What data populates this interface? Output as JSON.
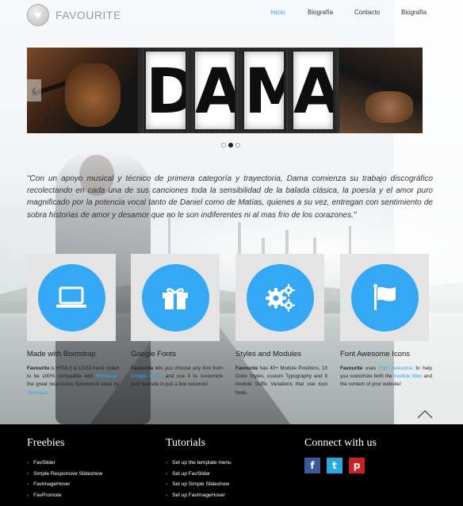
{
  "header": {
    "logo_text": "FAVOURITE",
    "logo_icon": "heart-icon",
    "nav": [
      {
        "label": "Inicio",
        "active": true
      },
      {
        "label": "Biografía",
        "active": false
      },
      {
        "label": "Contacto",
        "active": false
      },
      {
        "label": "Biografía",
        "active": false
      }
    ]
  },
  "slider": {
    "banner_text": "DAMA",
    "prev_icon": "chevron-left-icon",
    "next_icon": "chevron-right-icon",
    "slide_count": 3,
    "active_slide": 2
  },
  "quote": "\"Con un apoyo musical y técnico de primera categoría y trayectoria, Dama comienza su trabajo discográfico recolectando en cada una de sus canciones toda la sensibilidad de la balada clásica, la poesía y el amor puro magnificado por la potencia vocal tanto de Daniel como de Matías, quienes a su vez, entregan con sentimiento de sobra historias de amor y desamor que no le son indiferentes ni al mas frio de los corazones.\"",
  "features": [
    {
      "icon": "laptop-icon",
      "title": "Made with Bootstrap",
      "parts": [
        {
          "t": "Favourite",
          "s": "b"
        },
        {
          "t": " is HTML5 & CSS3 hand coded to be 100% compatible with ",
          "s": ""
        },
        {
          "t": "Bootstrap",
          "s": "lnk"
        },
        {
          "t": ", the great responsive framework used by ",
          "s": ""
        },
        {
          "t": "Joomla!3",
          "s": "lnk"
        },
        {
          "t": ".",
          "s": ""
        }
      ]
    },
    {
      "icon": "gift-icon",
      "title": "Google Fonts",
      "parts": [
        {
          "t": "Favourite",
          "s": "b"
        },
        {
          "t": " lets you choose any font from ",
          "s": ""
        },
        {
          "t": "Google Fonts",
          "s": "lnk"
        },
        {
          "t": " and use it to customize your website in just a few seconds!",
          "s": ""
        }
      ]
    },
    {
      "icon": "gears-icon",
      "title": "Styles and Modules",
      "parts": [
        {
          "t": "Favourite",
          "s": "b"
        },
        {
          "t": " has 40+ Module Positions, 10 Color Styles, custom Typography and 8 module Suffix Variations that use icon fonts.",
          "s": ""
        }
      ]
    },
    {
      "icon": "flag-icon",
      "title": "Font Awesome Icons",
      "parts": [
        {
          "t": "Favourite",
          "s": "b"
        },
        {
          "t": " uses ",
          "s": ""
        },
        {
          "t": "Font Awesome",
          "s": "lnk"
        },
        {
          "t": " to help you customize both the ",
          "s": ""
        },
        {
          "t": "module titles",
          "s": "lnk"
        },
        {
          "t": " and the content of your website!",
          "s": ""
        }
      ]
    }
  ],
  "back_to_top_icon": "chevron-up-icon",
  "footer": {
    "columns": [
      {
        "title": "Freebies",
        "items": [
          "FavSlider",
          "Simple Responsive Slideshow",
          "FavImageHover",
          "FavPromote"
        ]
      },
      {
        "title": "Tutorials",
        "items": [
          "Set up the template menu",
          "Set up FavSlider",
          "Set up Simple Slideshow",
          "Set up FavImageHover"
        ]
      }
    ],
    "connect_title": "Connect with us",
    "social": [
      {
        "name": "facebook-icon",
        "glyph": "f",
        "color": "#3b5998"
      },
      {
        "name": "twitter-icon",
        "glyph": "t",
        "color": "#2aa9e0"
      },
      {
        "name": "pinterest-icon",
        "glyph": "p",
        "color": "#cb2027"
      }
    ]
  },
  "colors": {
    "accent": "#35a8f5",
    "link": "#29a7f2",
    "footer_bg": "#000000",
    "tile_bg": "#e4e4e4"
  }
}
